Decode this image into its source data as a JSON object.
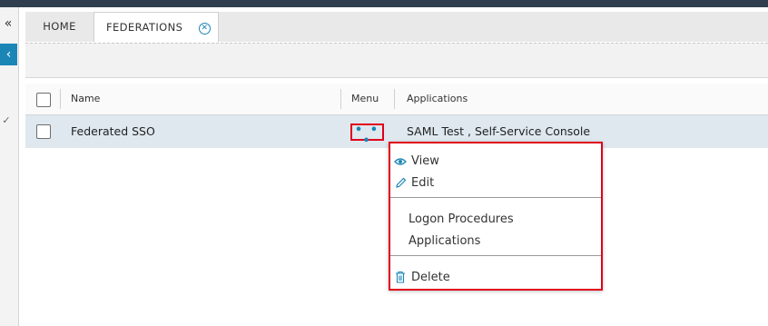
{
  "tabs": {
    "home": "HOME",
    "federations": "FEDERATIONS"
  },
  "columns": {
    "name": "Name",
    "menu": "Menu",
    "applications": "Applications"
  },
  "row": {
    "name": "Federated SSO",
    "applications": "SAML Test , Self-Service Console"
  },
  "menu_trigger": "• • •",
  "dropdown": {
    "view": "View",
    "edit": "Edit",
    "logon_procedures": "Logon Procedures",
    "applications": "Applications",
    "delete": "Delete"
  },
  "icons": {
    "collapse": "double-chevron-left-icon",
    "back": "chevron-left-icon",
    "check": "check-icon",
    "close": "close-circle-icon",
    "view": "eye-icon",
    "edit": "pencil-icon",
    "delete": "trash-icon"
  },
  "colors": {
    "accent": "#1b86b6",
    "highlight_box": "#e0001a",
    "row_selected": "#dfe8ef",
    "topbar": "#2f3f4f"
  }
}
